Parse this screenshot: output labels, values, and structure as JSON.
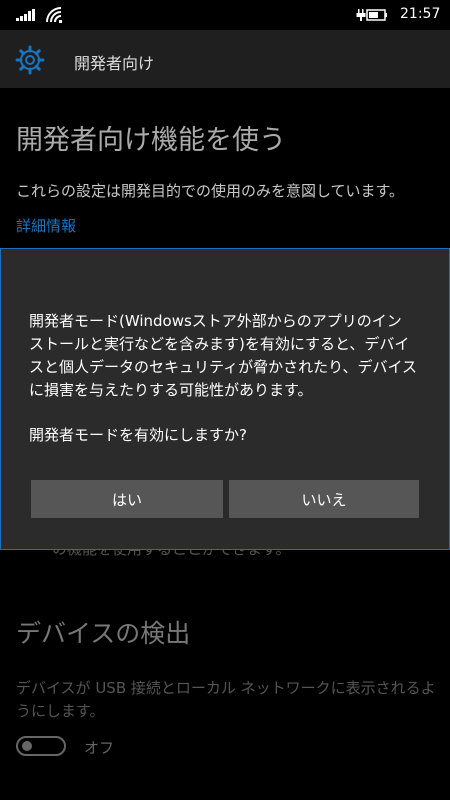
{
  "status_bar": {
    "time": "21:57",
    "signal_icon": "cellular-signal-icon",
    "wifi_icon": "wifi-icon",
    "charging_icon": "charging-plug-icon",
    "battery_icon": "battery-icon"
  },
  "header": {
    "icon": "gear-icon",
    "title": "開発者向け"
  },
  "background": {
    "title": "開発者向け機能を使う",
    "description": "これらの設定は開発目的での使用のみを意図しています。",
    "link": "詳細情報",
    "obscured_text": "の機能を使用することができます。",
    "section_title": "デバイスの検出",
    "section_desc": "デバイスが USB 接続とローカル ネットワークに表示されるようにします。",
    "toggle_label": "オフ"
  },
  "dialog": {
    "message_lines": [
      "開発者モード(Windowsストア外部からのアプリのイン",
      "ストールと実行などを含みます)を有効にすると、デバイ",
      "スと個人データのセキュリティが脅かされたり、デバイス",
      "に損害を与えたりする可能性があります。"
    ],
    "question": "開発者モードを有効にしますか?",
    "yes_label": "はい",
    "no_label": "いいえ"
  },
  "colors": {
    "accent": "#1a75c0",
    "dialog_bg": "#2b2b2b",
    "button_bg": "#565656",
    "header_bg": "#1f1f1f"
  }
}
